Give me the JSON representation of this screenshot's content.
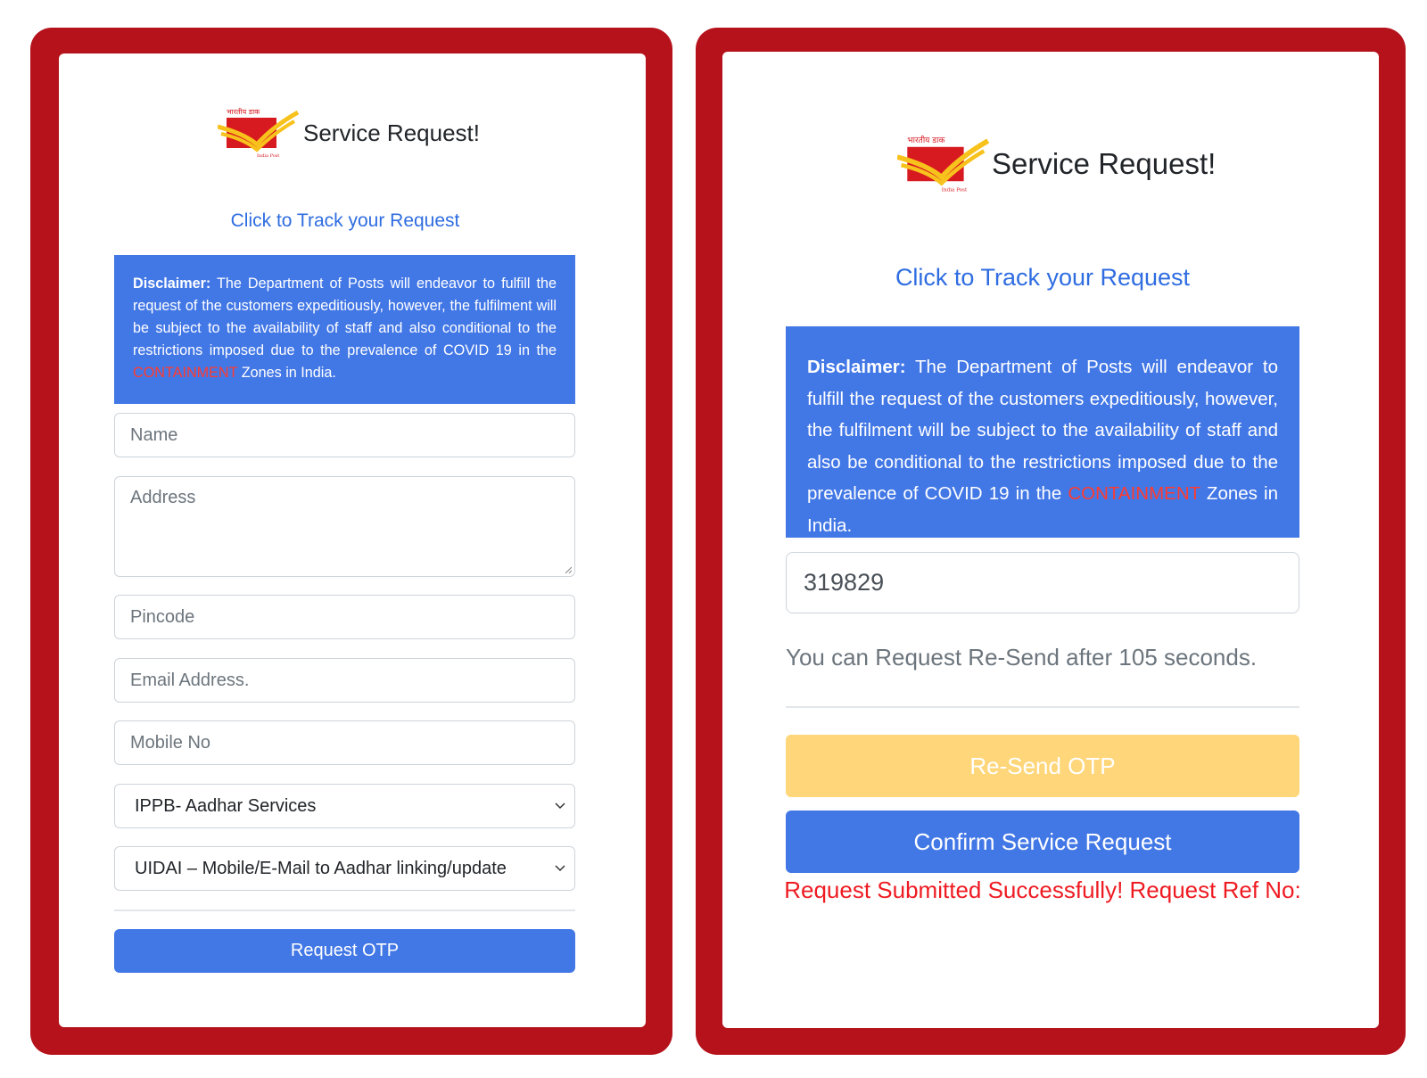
{
  "left_panel": {
    "title": "Service Request!",
    "track_link": "Click to Track your Request",
    "disclaimer": {
      "label": "Disclaimer:",
      "text_before": " The Department of Posts will endeavor to fulfill the request of the customers expeditiously, however, the fulfilment will be subject to the availability of staff and also conditional to the restrictions imposed due to the prevalence of COVID 19 in the ",
      "highlight": "CONTAINMENT",
      "text_after": " Zones in India."
    },
    "fields": {
      "name_placeholder": "Name",
      "address_placeholder": "Address",
      "pincode_placeholder": "Pincode",
      "email_placeholder": "Email Address.",
      "mobile_placeholder": "Mobile No"
    },
    "service_select": {
      "selected": "IPPB- Aadhar Services"
    },
    "subservice_select": {
      "selected": "UIDAI – Mobile/E-Mail to Aadhar linking/update"
    },
    "request_otp_label": "Request OTP"
  },
  "right_panel": {
    "title": "Service Request!",
    "track_link": "Click to Track your Request",
    "disclaimer": {
      "label": "Disclaimer:",
      "text_before": " The Department of Posts will endeavor to fulfill the request of the customers expeditiously, however, the fulfilment will be subject to the availability of staff and also be conditional to the restrictions imposed due to the prevalence of COVID 19 in the ",
      "highlight": "CONTAINMENT",
      "text_after": " Zones in India."
    },
    "otp_value": "319829",
    "resend_message": "You can Request Re-Send after 105 seconds.",
    "resend_label": "Re-Send OTP",
    "confirm_label": "Confirm Service Request",
    "success_message": "Request Submitted Successfully! Request Ref No:"
  },
  "logo": {
    "hindi_text": "भारतीय डाक",
    "english_text": "India Post"
  },
  "colors": {
    "frame": "#b5121b",
    "primary": "#4277e6",
    "warning": "#ffd679",
    "link": "#2f6de1",
    "error": "#ee1b22"
  }
}
